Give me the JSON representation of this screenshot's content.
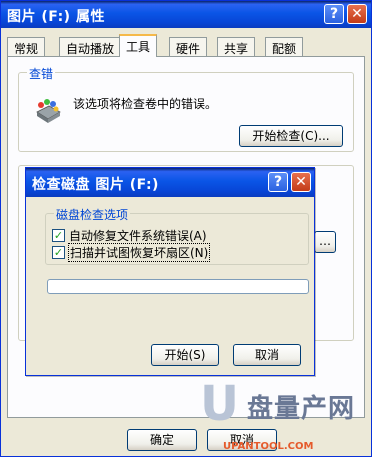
{
  "properties_window": {
    "title": "图片 (F:) 属性",
    "tabs": [
      {
        "label": "常规"
      },
      {
        "label": "自动播放"
      },
      {
        "label": "工具"
      },
      {
        "label": "硬件"
      },
      {
        "label": "共享"
      },
      {
        "label": "配额"
      }
    ],
    "error_check": {
      "group_label": "查错",
      "description": "该选项将检查卷中的错误。",
      "button_label": "开始检查(C)..."
    },
    "ok_label": "确定",
    "cancel_label": "取消"
  },
  "check_disk_dialog": {
    "title": "检查磁盘 图片 (F:)",
    "options_group_label": "磁盘检查选项",
    "option_fix_label": "自动修复文件系统错误(A)",
    "option_fix_checked": true,
    "option_scan_label": "扫描并试图恢复坏扇区(N)",
    "option_scan_checked": true,
    "progress": 0,
    "start_label": "开始(S)",
    "cancel_label": "取消"
  },
  "watermark": {
    "letter": "U",
    "brand": "盘量产网",
    "url": "UPANTOOL.COM"
  },
  "colors": {
    "titlebar": "#0a55e6",
    "window_bg": "#ece9d8",
    "group_label": "#0046d5",
    "close_button": "#c33b17"
  }
}
